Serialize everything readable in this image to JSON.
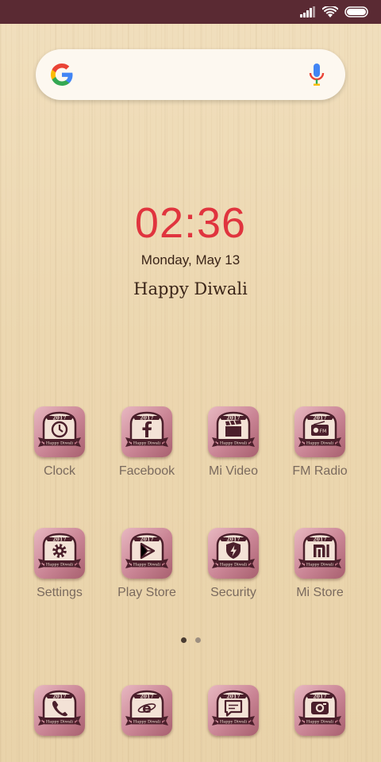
{
  "status_bar": {
    "icons": [
      "signal-icon",
      "wifi-icon",
      "battery-icon"
    ]
  },
  "search": {
    "icons": [
      "google-icon",
      "mic-icon"
    ]
  },
  "clock": {
    "time": "02:36",
    "date": "Monday, May 13",
    "time_color": "#e0343e"
  },
  "greeting": "Happy Diwali",
  "icon_badge": {
    "year": "2017",
    "banner": "Happy Diwali"
  },
  "apps": [
    {
      "label": "Clock",
      "icon": "clock-icon"
    },
    {
      "label": "Facebook",
      "icon": "facebook-icon"
    },
    {
      "label": "Mi Video",
      "icon": "clapperboard-icon"
    },
    {
      "label": "FM Radio",
      "icon": "radio-icon"
    },
    {
      "label": "Settings",
      "icon": "gear-icon"
    },
    {
      "label": "Play Store",
      "icon": "play-store-icon"
    },
    {
      "label": "Security",
      "icon": "shield-bolt-icon"
    },
    {
      "label": "Mi Store",
      "icon": "mi-logo-icon"
    }
  ],
  "dock": [
    {
      "icon": "phone-icon"
    },
    {
      "icon": "browser-icon"
    },
    {
      "icon": "messages-icon"
    },
    {
      "icon": "camera-icon"
    }
  ],
  "pager": {
    "pages": 2,
    "active": 1
  },
  "colors": {
    "status_bar": "#5a2a33",
    "icon_tile": "#c98494",
    "badge": "#4b1f2b"
  }
}
